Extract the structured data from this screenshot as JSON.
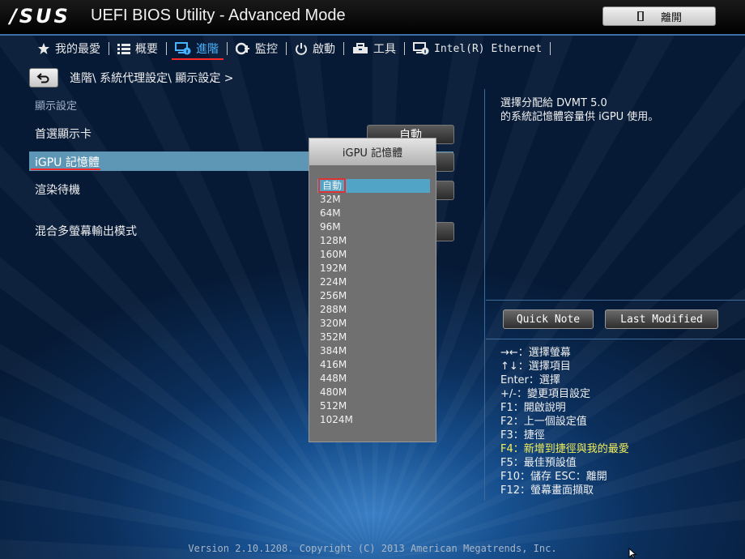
{
  "header": {
    "logo": "/SUS",
    "title": "UEFI BIOS Utility - Advanced Mode",
    "exit_label": "離開"
  },
  "tabs": [
    {
      "label": "我的最愛",
      "icon": "star-icon"
    },
    {
      "label": "概要",
      "icon": "list-icon"
    },
    {
      "label": "進階",
      "icon": "advanced-icon",
      "active": true
    },
    {
      "label": "監控",
      "icon": "monitor-icon"
    },
    {
      "label": "啟動",
      "icon": "power-icon"
    },
    {
      "label": "工具",
      "icon": "tool-icon"
    },
    {
      "label": "Intel(R) Ethernet",
      "icon": "ethernet-icon"
    }
  ],
  "breadcrumb": "進階\\ 系統代理設定\\ 顯示設定 >",
  "section_title": "顯示設定",
  "settings": [
    {
      "label": "首選顯示卡",
      "value": "自動"
    },
    {
      "label": "iGPU 記憶體",
      "value": ""
    },
    {
      "label": "渲染待機",
      "value": ""
    },
    {
      "label": "混合多螢幕輸出模式",
      "value": ""
    }
  ],
  "popup": {
    "title": "iGPU 記憶體",
    "options": [
      "自動",
      "32M",
      "64M",
      "96M",
      "128M",
      "160M",
      "192M",
      "224M",
      "256M",
      "288M",
      "320M",
      "352M",
      "384M",
      "416M",
      "448M",
      "480M",
      "512M",
      "1024M"
    ],
    "selected": "自動"
  },
  "help_lines": [
    "選擇分配給 DVMT 5.0",
    "的系統記憶體容量供 iGPU 使用。"
  ],
  "buttons": {
    "quick_note": "Quick Note",
    "last_modified": "Last Modified"
  },
  "keys": [
    "→←：選擇螢幕",
    "↑↓：選擇項目",
    "Enter：選擇",
    "+/-：變更項目設定",
    "F1：開啟說明",
    "F2：上一個設定值",
    "F3：捷徑",
    "F4：新增到捷徑與我的最愛",
    "F5：最佳預設值",
    "F10：儲存  ESC：離開",
    "F12：螢幕畫面擷取"
  ],
  "footer": "Version 2.10.1208. Copyright (C) 2013 American Megatrends, Inc.",
  "colors": {
    "accent_tab": "#49b3ff",
    "highlight_row": "#5e97b6",
    "red_marker": "#ff2b2b",
    "f4_key": "#f3ef5b"
  }
}
